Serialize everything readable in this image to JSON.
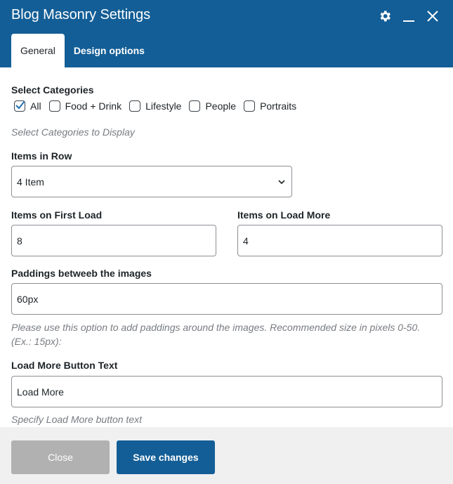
{
  "window": {
    "title": "Blog Masonry Settings"
  },
  "header_icons": [
    "gear-icon",
    "minimize-icon",
    "close-icon"
  ],
  "tabs": [
    {
      "label": "General",
      "active": true
    },
    {
      "label": "Design options",
      "active": false
    }
  ],
  "categories": {
    "label": "Select Categories",
    "items": [
      {
        "label": "All",
        "checked": true
      },
      {
        "label": "Food + Drink",
        "checked": false
      },
      {
        "label": "Lifestyle",
        "checked": false
      },
      {
        "label": "People",
        "checked": false
      },
      {
        "label": "Portraits",
        "checked": false
      }
    ],
    "help": "Select Categories to Display"
  },
  "items_in_row": {
    "label": "Items in Row",
    "value": "4 Item"
  },
  "first_load": {
    "label": "Items on First Load",
    "value": "8"
  },
  "load_more_count": {
    "label": "Items on Load More",
    "value": "4"
  },
  "paddings": {
    "label": "Paddings betweeb the images",
    "value": "60px",
    "help_line1": "Please use this option to add paddings around the images. Recommended size in pixels 0-50.",
    "help_line2": "(Ex.: 15px):"
  },
  "load_more_text": {
    "label": "Load More Button Text",
    "value": "Load More",
    "help": "Specify Load More button text"
  },
  "footer": {
    "close_label": "Close",
    "save_label": "Save changes"
  },
  "colors": {
    "header": "#135e96",
    "primary": "#135e96",
    "disabled": "#b1b1b1",
    "footer_bg": "#f0f0f1",
    "help_text": "#787c82"
  }
}
